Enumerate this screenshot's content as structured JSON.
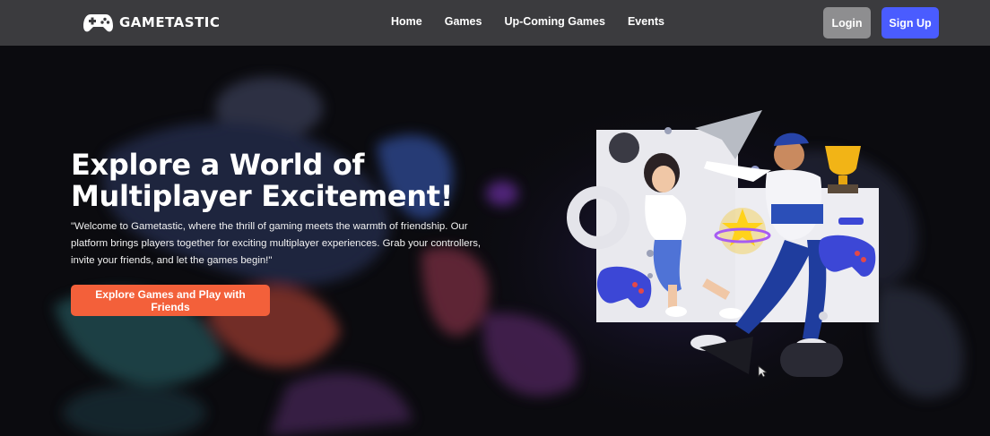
{
  "brand": {
    "name": "GAMETASTIC",
    "icon": "gamepad-icon"
  },
  "nav": {
    "links": [
      {
        "label": "Home"
      },
      {
        "label": "Games"
      },
      {
        "label": "Up-Coming Games"
      },
      {
        "label": "Events"
      }
    ],
    "login_label": "Login",
    "signup_label": "Sign Up"
  },
  "hero": {
    "title_line1": "Explore a World of",
    "title_line2": "Multiplayer Excitement!",
    "description": "\"Welcome to Gametastic, where the thrill of gaming meets the warmth of friendship. Our platform brings players together for exciting multiplayer experiences. Grab your controllers, invite your friends, and let the games begin!\"",
    "cta_label": "Explore Games and Play with Friends"
  },
  "colors": {
    "navbar": "#3b3b3e",
    "login": "#8e8e90",
    "signup": "#4a5cff",
    "cta": "#f3603a",
    "background": "#0a0a0d"
  }
}
